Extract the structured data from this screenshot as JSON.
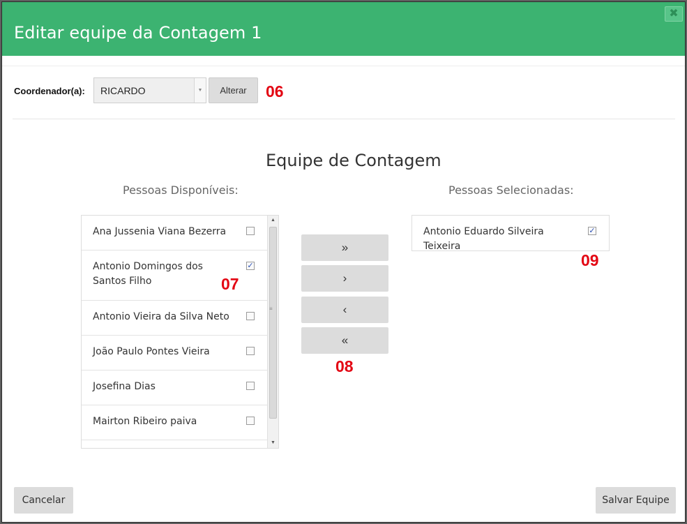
{
  "modal": {
    "title": "Editar equipe da Contagem 1",
    "close_icon": "close-icon",
    "header_color": "#3cb371"
  },
  "coordinator": {
    "label": "Coordenador(a):",
    "selected": "RICARDO",
    "change_button": "Alterar",
    "annotation": "06"
  },
  "team": {
    "title": "Equipe de Contagem",
    "available_label": "Pessoas Disponíveis:",
    "selected_label": "Pessoas Selecionadas:",
    "available": [
      {
        "name": "Ana Jussenia Viana Bezerra",
        "checked": false
      },
      {
        "name": "Antonio Domingos dos Santos Filho",
        "checked": true
      },
      {
        "name": "Antonio Vieira da Silva Neto",
        "checked": false
      },
      {
        "name": "João Paulo Pontes Vieira",
        "checked": false
      },
      {
        "name": "Josefina Dias",
        "checked": false
      },
      {
        "name": "Mairton Ribeiro paiva",
        "checked": false
      }
    ],
    "selected": [
      {
        "name": "Antonio Eduardo Silveira Teixeira",
        "checked": true
      }
    ],
    "available_annotation": "07",
    "buttons_annotation": "08",
    "selected_annotation": "09"
  },
  "move_buttons": {
    "move_all_right": "»",
    "move_right": "›",
    "move_left": "‹",
    "move_all_left": "«"
  },
  "footer": {
    "cancel": "Cancelar",
    "save": "Salvar Equipe"
  }
}
